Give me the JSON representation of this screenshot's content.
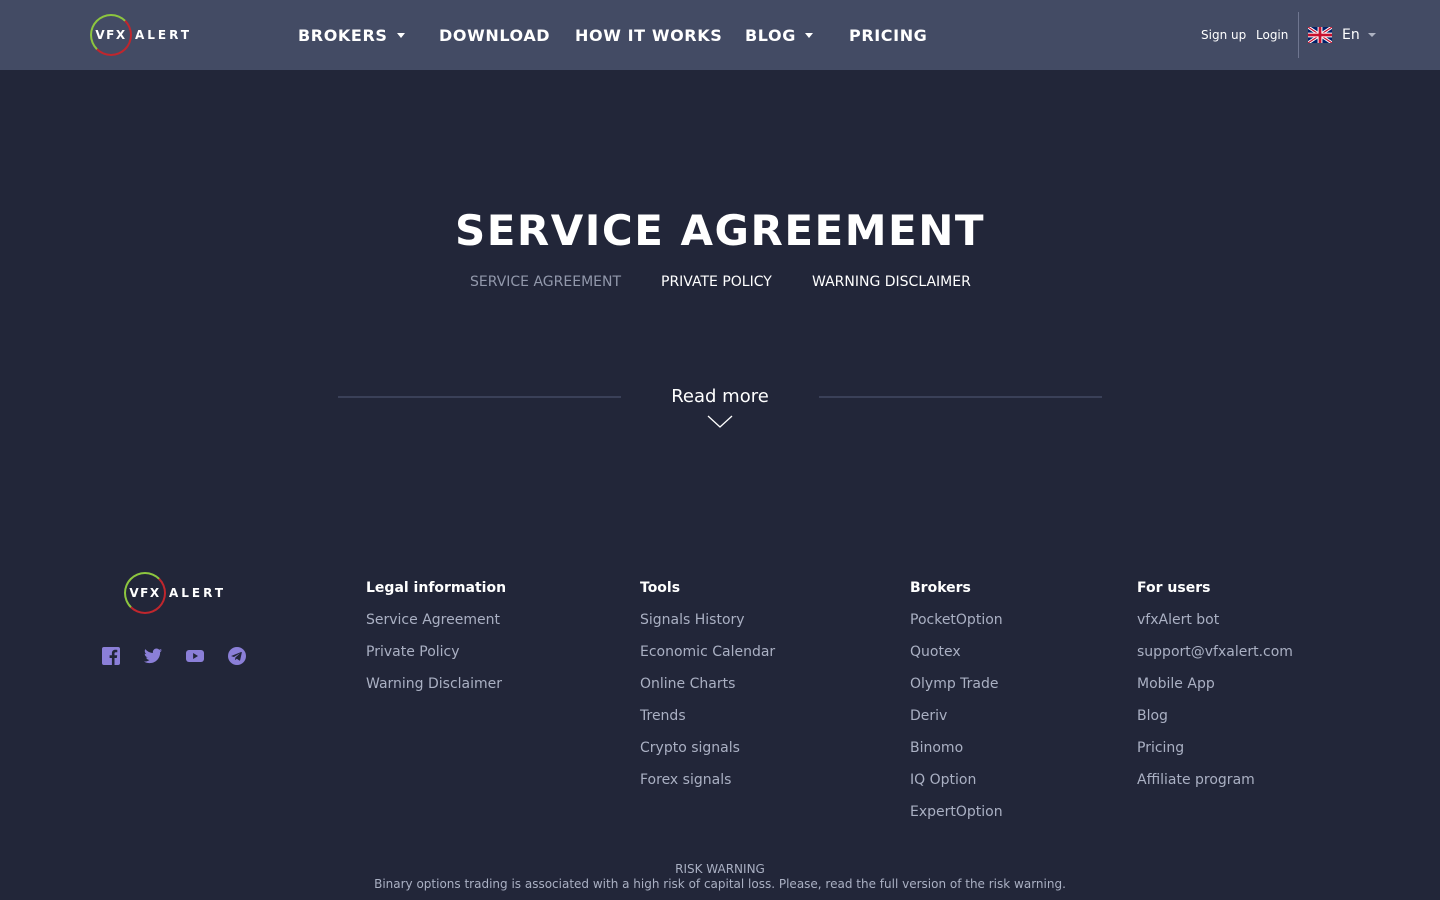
{
  "brand": {
    "logo_circle": "VFX",
    "logo_word": "ALERT"
  },
  "nav": {
    "brokers": "BROKERS",
    "download": "DOWNLOAD",
    "how_it_works": "HOW IT WORKS",
    "blog": "BLOG",
    "pricing": "PRICING"
  },
  "auth": {
    "signup": "Sign up",
    "login": "Login"
  },
  "language": {
    "label": "En",
    "flag_icon": "uk-flag-icon"
  },
  "page": {
    "title": "SERVICE AGREEMENT",
    "tabs": [
      "SERVICE AGREEMENT",
      "PRIVATE POLICY",
      "WARNING DISCLAIMER"
    ],
    "active_tab": "SERVICE AGREEMENT",
    "read_more": "Read more"
  },
  "footer": {
    "social_icons": [
      "facebook-icon",
      "twitter-icon",
      "youtube-icon",
      "telegram-icon"
    ],
    "legal": {
      "title": "Legal information",
      "links": [
        "Service Agreement",
        "Private Policy",
        "Warning Disclaimer"
      ]
    },
    "tools": {
      "title": "Tools",
      "links": [
        "Signals History",
        "Economic Calendar",
        "Online Charts",
        "Trends",
        "Crypto signals",
        "Forex signals"
      ]
    },
    "brokers": {
      "title": "Brokers",
      "links": [
        "PocketOption",
        "Quotex",
        "Olymp Trade",
        "Deriv",
        "Binomo",
        "IQ Option",
        "ExpertOption"
      ]
    },
    "users": {
      "title": "For users",
      "links": [
        "vfxAlert bot",
        "support@vfxalert.com",
        "Mobile App",
        "Blog",
        "Pricing",
        "Affiliate program"
      ]
    },
    "risk_title": "RISK WARNING",
    "risk_text": "Binary options trading is associated with a high risk of capital loss. Please, read the full version of the risk warning."
  },
  "colors": {
    "background": "#222639",
    "header": "#434b64",
    "muted_text": "#aab0c3",
    "social_icon": "#8b7fd8",
    "logo_red": "#c0262d",
    "logo_green": "#8dc63f"
  }
}
